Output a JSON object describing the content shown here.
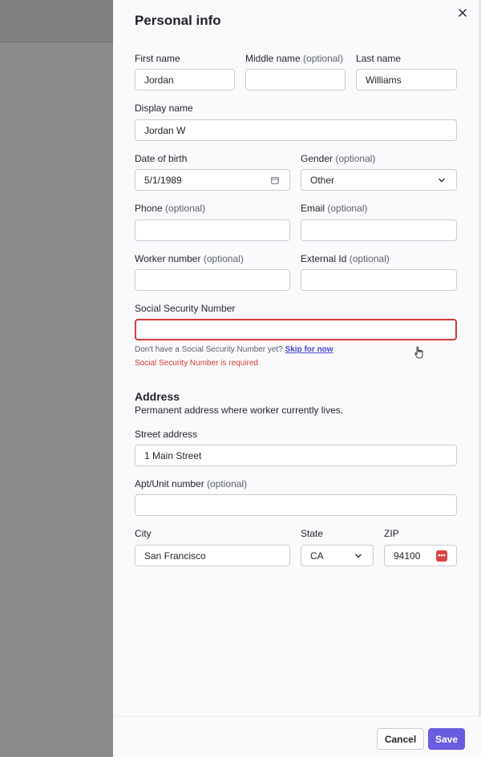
{
  "panel": {
    "title": "Personal info"
  },
  "fields": {
    "first_name": {
      "label": "First name",
      "value": "Jordan"
    },
    "middle_name": {
      "label": "Middle name",
      "optional": "(optional)",
      "value": ""
    },
    "last_name": {
      "label": "Last name",
      "value": "Williams"
    },
    "display_name": {
      "label": "Display name",
      "value": "Jordan W"
    },
    "dob": {
      "label": "Date of birth",
      "value": "5/1/1989"
    },
    "gender": {
      "label": "Gender",
      "optional": "(optional)",
      "value": "Other"
    },
    "phone": {
      "label": "Phone",
      "optional": "(optional)",
      "value": ""
    },
    "email": {
      "label": "Email",
      "optional": "(optional)",
      "value": ""
    },
    "worker_number": {
      "label": "Worker number",
      "optional": "(optional)",
      "value": ""
    },
    "external_id": {
      "label": "External Id",
      "optional": "(optional)",
      "value": ""
    },
    "ssn": {
      "label": "Social Security Number",
      "value": "",
      "hint": "Don't have a Social Security Number yet?",
      "hint_link": "Skip for now",
      "error": "Social Security Number is required"
    }
  },
  "address": {
    "title": "Address",
    "subtitle": "Permanent address where worker currently lives.",
    "street": {
      "label": "Street address",
      "value": "1 Main Street"
    },
    "apt": {
      "label": "Apt/Unit number",
      "optional": "(optional)",
      "value": ""
    },
    "city": {
      "label": "City",
      "value": "San Francisco"
    },
    "state": {
      "label": "State",
      "value": "CA"
    },
    "zip": {
      "label": "ZIP",
      "value": "94100",
      "badge": "•••"
    }
  },
  "footer": {
    "cancel_label": "Cancel",
    "save_label": "Save"
  },
  "colors": {
    "primary": "#6a5ce0",
    "error": "#d83b3b",
    "link": "#4a47c9"
  }
}
